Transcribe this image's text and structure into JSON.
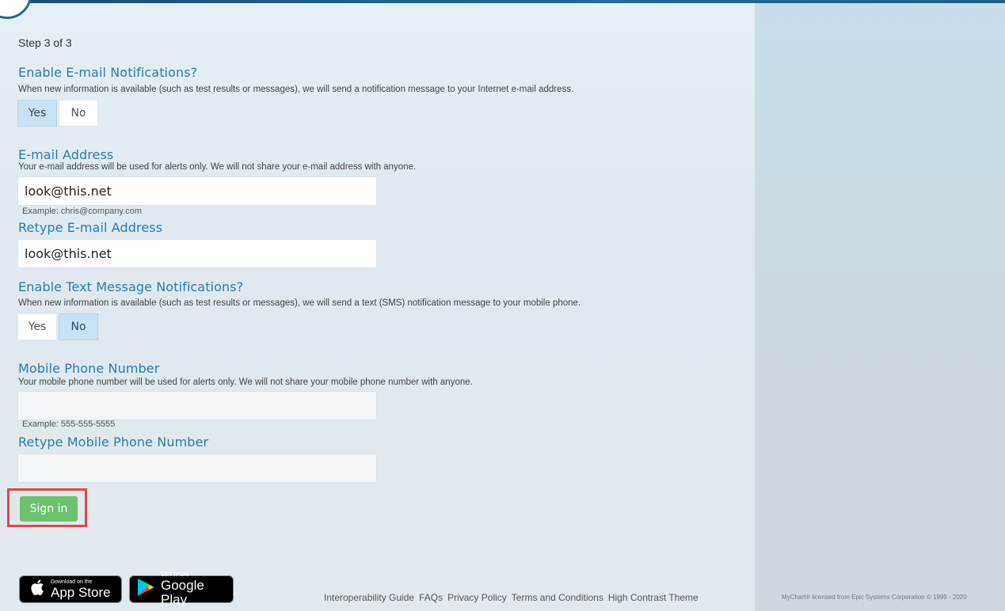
{
  "step": "Step 3 of 3",
  "email_notify": {
    "heading": "Enable E-mail Notifications?",
    "description": "When new information is available (such as test results or messages), we will send a notification message to your Internet e-mail address.",
    "yes": "Yes",
    "no": "No",
    "selected": "Yes"
  },
  "email": {
    "heading": "E-mail Address",
    "description": "Your e-mail address will be used for alerts only. We will not share your e-mail address with anyone.",
    "value": "look@this.net",
    "example": "Example: chris@company.com"
  },
  "email_retype": {
    "heading": "Retype E-mail Address",
    "value": "look@this.net"
  },
  "text_notify": {
    "heading": "Enable Text Message Notifications?",
    "description": "When new information is available (such as test results or messages), we will send a text (SMS) notification message to your mobile phone.",
    "yes": "Yes",
    "no": "No",
    "selected": "No"
  },
  "phone": {
    "heading": "Mobile Phone Number",
    "description": "Your mobile phone number will be used for alerts only. We will not share your mobile phone number with anyone.",
    "value": "",
    "example": "Example: 555-555-5555"
  },
  "phone_retype": {
    "heading": "Retype Mobile Phone Number",
    "value": ""
  },
  "signin_label": "Sign in",
  "badges": {
    "appstore_small": "Download on the",
    "appstore_big": "App Store",
    "googleplay_small": "GET IT ON",
    "googleplay_big": "Google Play"
  },
  "footer": {
    "links": [
      "Interoperability Guide",
      "FAQs",
      "Privacy Policy",
      "Terms and Conditions",
      "High Contrast Theme"
    ],
    "copyright": "MyChart® licensed from Epic Systems Corporation © 1999 - 2020"
  },
  "colors": {
    "accent": "#2b7cae",
    "signin": "#6cc26d",
    "selected_toggle": "#c9e2f4",
    "highlight_box": "#e0464d"
  }
}
